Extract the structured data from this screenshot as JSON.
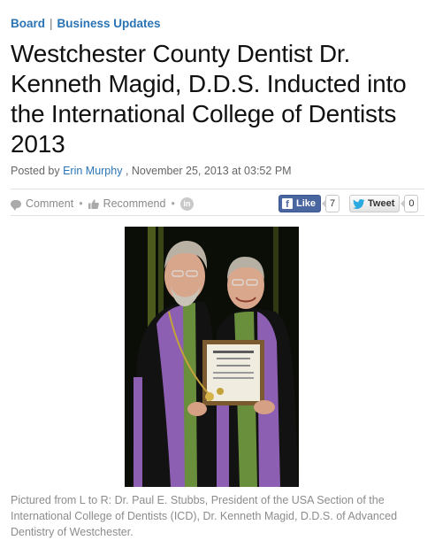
{
  "breadcrumb": {
    "section": "Board",
    "separator": "|",
    "category": "Business Updates"
  },
  "article": {
    "title": "Westchester County Dentist Dr. Kenneth Magid, D.D.S. Inducted into the International College of Dentists 2013",
    "byline": {
      "prefix": "Posted by",
      "author": "Erin Murphy",
      "date": ", November 25, 2013 at 03:52 PM"
    },
    "caption": "Pictured from L to R: Dr. Paul E. Stubbs, President of the USA Section of the International College of Dentists (ICD), Dr. Kenneth Magid, D.D.S. of Advanced Dentistry of Westchester."
  },
  "actions": {
    "comment_label": "Comment",
    "separator": "•",
    "recommend_label": "Recommend",
    "linkedin_glyph": "in"
  },
  "social": {
    "facebook": {
      "glyph": "f",
      "label": "Like",
      "count": "7"
    },
    "twitter": {
      "label": "Tweet",
      "count": "0"
    }
  },
  "icons": {
    "comment": "speech-bubble-icon",
    "recommend": "thumbs-up-icon",
    "linkedin": "linkedin-icon",
    "facebook": "facebook-icon",
    "twitter": "twitter-bird-icon"
  },
  "colors": {
    "link": "#2a74b6",
    "facebook": "#4a66a0",
    "twitter": "#2aa9e0",
    "muted_text": "#8c8c8c",
    "gown_black": "#111111",
    "gown_purple": "#8d5fb2",
    "gown_green": "#6a8f3c"
  }
}
